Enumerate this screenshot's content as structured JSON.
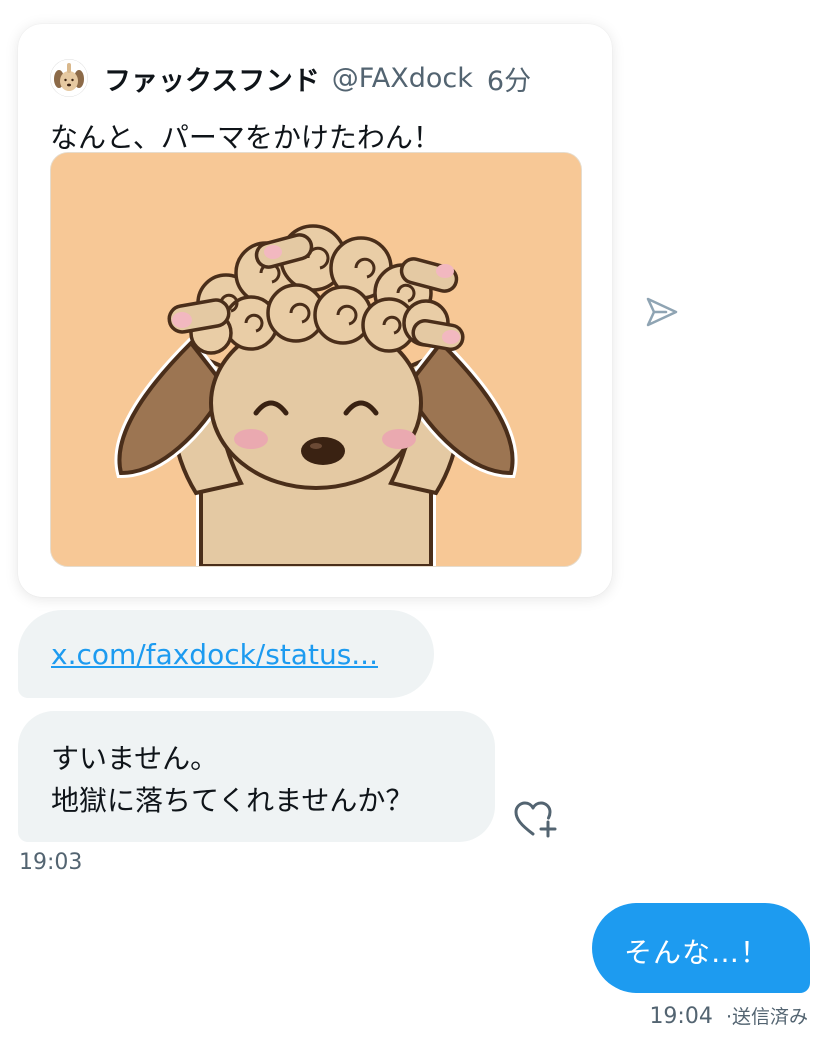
{
  "quoted_tweet": {
    "author_name": "ファックスフンド",
    "author_handle": "@FAXdock",
    "time": "6分",
    "text": "なんと、パーマをかけたわん！",
    "avatar_icon": "dog-avatar-icon",
    "image_icon": "curly-dog-illustration"
  },
  "link_message": {
    "text": "x.com/faxdock/status..."
  },
  "incoming_message": {
    "line1": "すいません。",
    "line2": "地獄に落ちてくれませんか？",
    "timestamp": "19:03"
  },
  "outgoing_message": {
    "text": "そんな…！",
    "timestamp": "19:04",
    "separator": "·",
    "status": "送信済み"
  },
  "colors": {
    "accent": "#1d9bf0",
    "bubble_incoming": "#eff3f4",
    "secondary_text": "#536471",
    "image_background": "#f7c896"
  },
  "icons": {
    "share": "share-send-icon",
    "reaction": "add-reaction-heart-icon"
  }
}
